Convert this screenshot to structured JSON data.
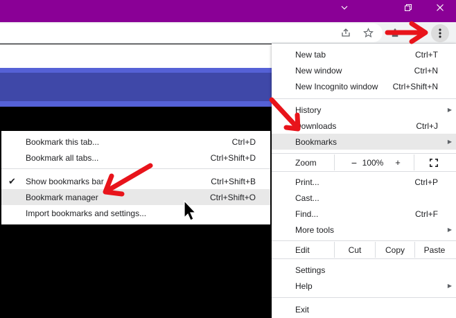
{
  "colors": {
    "title_bar": "#8a0096",
    "annotation_arrow": "#e8141b",
    "highlight": "#e8e8e8"
  },
  "titlebar": {
    "controls": [
      "chevron-down-icon",
      "restore-icon",
      "close-icon"
    ]
  },
  "toolbar": {
    "icons": [
      "share-icon",
      "star-icon",
      "extensions-icon",
      "more-vert-icon"
    ]
  },
  "main_menu": {
    "new_tab": {
      "label": "New tab",
      "shortcut": "Ctrl+T"
    },
    "new_window": {
      "label": "New window",
      "shortcut": "Ctrl+N"
    },
    "new_incognito": {
      "label": "New Incognito window",
      "shortcut": "Ctrl+Shift+N"
    },
    "history": {
      "label": "History"
    },
    "downloads": {
      "label": "Downloads",
      "shortcut": "Ctrl+J"
    },
    "bookmarks": {
      "label": "Bookmarks"
    },
    "zoom": {
      "label": "Zoom",
      "minus": "−",
      "value": "100%",
      "plus": "+"
    },
    "print": {
      "label": "Print...",
      "shortcut": "Ctrl+P"
    },
    "cast": {
      "label": "Cast..."
    },
    "find": {
      "label": "Find...",
      "shortcut": "Ctrl+F"
    },
    "more_tools": {
      "label": "More tools"
    },
    "edit": {
      "label": "Edit",
      "cut": "Cut",
      "copy": "Copy",
      "paste": "Paste"
    },
    "settings": {
      "label": "Settings"
    },
    "help": {
      "label": "Help"
    },
    "exit": {
      "label": "Exit"
    }
  },
  "bookmarks_submenu": {
    "bookmark_tab": {
      "label": "Bookmark this tab...",
      "shortcut": "Ctrl+D"
    },
    "bookmark_all": {
      "label": "Bookmark all tabs...",
      "shortcut": "Ctrl+Shift+D"
    },
    "show_bar": {
      "label": "Show bookmarks bar",
      "shortcut": "Ctrl+Shift+B",
      "checked": true
    },
    "manager": {
      "label": "Bookmark manager",
      "shortcut": "Ctrl+Shift+O"
    },
    "import": {
      "label": "Import bookmarks and settings..."
    }
  }
}
